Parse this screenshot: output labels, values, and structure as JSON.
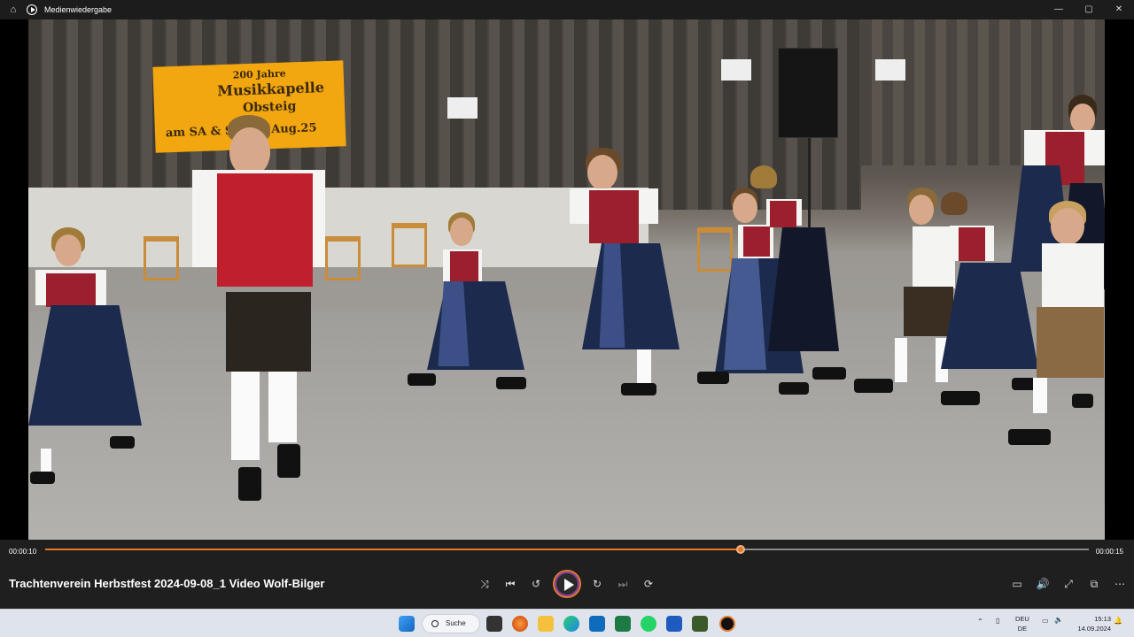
{
  "window": {
    "app_name": "Medienwiedergabe",
    "controls": {
      "minimize": "—",
      "maximize": "▢",
      "close": "✕"
    }
  },
  "video": {
    "sign_lines": [
      "200 Jahre",
      "Musikkapelle",
      "Obsteig",
      "am SA & SO 03. Aug.25"
    ]
  },
  "player": {
    "title": "Trachtenverein Herbstfest 2024-09-08_1 Video Wolf-Bilger",
    "current_time": "00:00:10",
    "total_time": "00:00:15",
    "progress_fraction": 0.6667,
    "accent_color": "#e07a2f",
    "buttons": {
      "shuffle": "⤨",
      "previous": "⏮",
      "rewind": "↺",
      "forward": "↻",
      "next": "⏭",
      "repeat": "⟳",
      "miniplayer": "▭",
      "volume": "🔊",
      "fullscreen": "⤢",
      "cast": "⧉",
      "more": "⋯"
    }
  },
  "taskbar": {
    "search_label": "Suche",
    "language_line1": "DEU",
    "language_line2": "DE",
    "time": "15:13",
    "date": "14.09.2024"
  }
}
